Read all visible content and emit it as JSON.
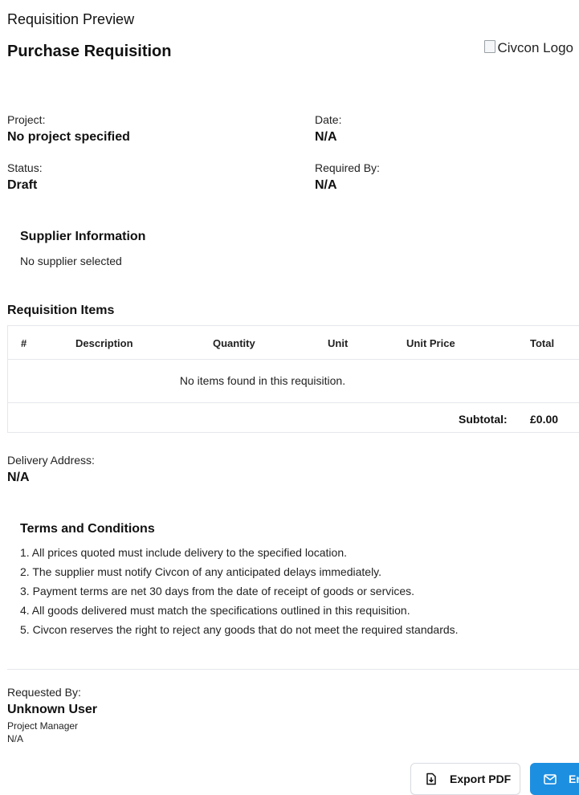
{
  "header": {
    "preview_title": "Requisition Preview",
    "document_title": "Purchase Requisition",
    "logo_alt": "Civcon Logo"
  },
  "meta": {
    "project_label": "Project:",
    "project_value": "No project specified",
    "date_label": "Date:",
    "date_value": "N/A",
    "status_label": "Status:",
    "status_value": "Draft",
    "required_by_label": "Required By:",
    "required_by_value": "N/A"
  },
  "supplier": {
    "title": "Supplier Information",
    "text": "No supplier selected"
  },
  "items": {
    "title": "Requisition Items",
    "columns": [
      "#",
      "Description",
      "Quantity",
      "Unit",
      "Unit Price",
      "Total"
    ],
    "empty_message": "No items found in this requisition.",
    "subtotal_label": "Subtotal:",
    "subtotal_value": "£0.00"
  },
  "delivery": {
    "label": "Delivery Address:",
    "value": "N/A"
  },
  "terms": {
    "title": "Terms and Conditions",
    "items": [
      "1. All prices quoted must include delivery to the specified location.",
      "2. The supplier must notify Civcon of any anticipated delays immediately.",
      "3. Payment terms are net 30 days from the date of receipt of goods or services.",
      "4. All goods delivered must match the specifications outlined in this requisition.",
      "5. Civcon reserves the right to reject any goods that do not meet the required standards."
    ]
  },
  "requester": {
    "label": "Requested By:",
    "name": "Unknown User",
    "role": "Project Manager",
    "extra": "N/A"
  },
  "actions": {
    "export_label": "Export PDF",
    "email_label": "Em",
    "export_icon": "file-download-icon",
    "email_icon": "mail-icon",
    "email_color": "#1d8fe1"
  }
}
